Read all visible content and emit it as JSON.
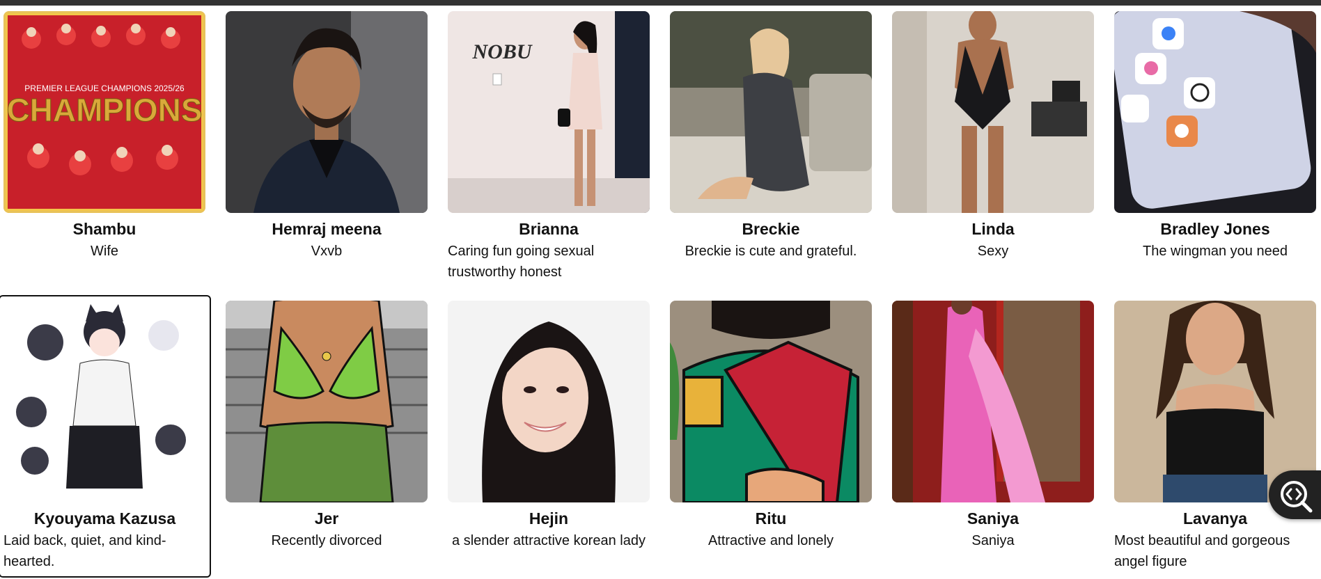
{
  "characters": [
    {
      "name": "Shambu",
      "description": "Wife",
      "image_alt": "premier-league-champions-poster",
      "image_text": "PREMIER LEAGUE CHAMPIONS 2025/26"
    },
    {
      "name": "Hemraj meena",
      "description": "Vxvb",
      "image_alt": "man-in-blazer-portrait"
    },
    {
      "name": "Brianna",
      "description": "Caring fun going sexual trustworthy honest",
      "image_alt": "woman-by-nobu-sign",
      "image_text": "NOBU"
    },
    {
      "name": "Breckie",
      "description": "Breckie is cute and grateful.",
      "image_alt": "woman-sitting-outdoors"
    },
    {
      "name": "Linda",
      "description": "Sexy",
      "image_alt": "woman-in-black-swimsuit"
    },
    {
      "name": "Bradley Jones",
      "description": "The wingman you need",
      "image_alt": "phone-with-ai-app-icons"
    },
    {
      "name": "Kyouyama Kazusa",
      "description": "Laid back, quiet, and kind-hearted.",
      "image_alt": "anime-character-sheet"
    },
    {
      "name": "Jer",
      "description": "Recently divorced",
      "image_alt": "cartoon-woman-green-bikini"
    },
    {
      "name": "Hejin",
      "description": "a slender attractive korean lady",
      "image_alt": "smiling-woman-portrait"
    },
    {
      "name": "Ritu",
      "description": "Attractive and lonely",
      "image_alt": "cartoon-woman-in-saree"
    },
    {
      "name": "Saniya",
      "description": "Saniya",
      "image_alt": "woman-in-pink-saree"
    },
    {
      "name": "Lavanya",
      "description": "Most beautiful and gorgeous angel figure",
      "image_alt": "woman-in-black-tank-top"
    }
  ],
  "floating_button": {
    "icon": "code-search-icon"
  },
  "colors": {
    "topbar": "#333333",
    "selected_outline": "#111111",
    "fab": "#222222"
  }
}
